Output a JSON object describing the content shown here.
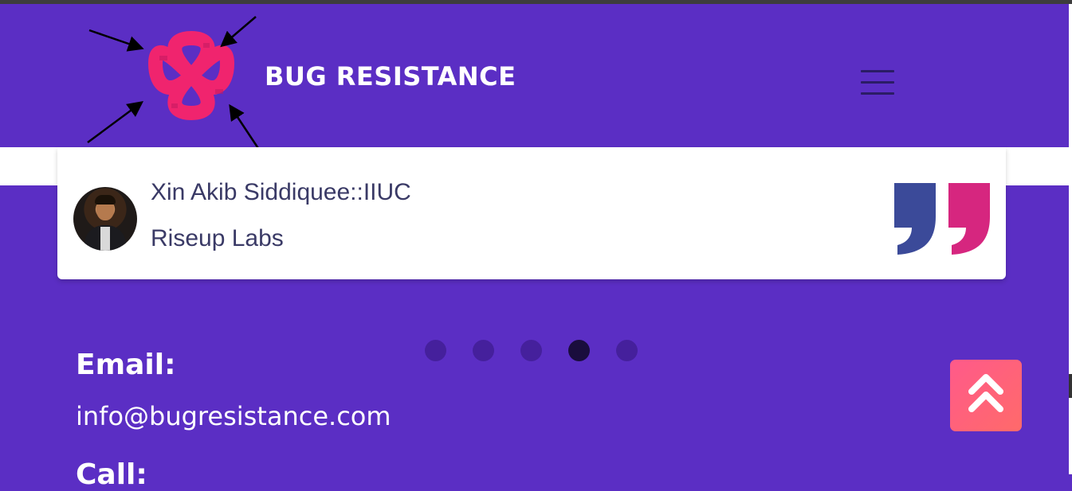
{
  "header": {
    "brand_title": "BUG RESISTANCE",
    "logo_icon": "clover-knot-logo-icon",
    "menu_icon": "hamburger-menu-icon"
  },
  "testimonial": {
    "name": "Xin Akib Siddiquee::IIUC",
    "company": "Riseup Labs",
    "quote_icon": "closing-quote-icon"
  },
  "carousel": {
    "dot_count": 5,
    "active_index": 3
  },
  "contact": {
    "email_label": "Email:",
    "email_value": "info@bugresistance.com",
    "call_label": "Call:"
  },
  "scroll_top": {
    "icon": "double-chevron-up-icon"
  },
  "colors": {
    "background": "#5b2ec4",
    "logo_pink": "#f0246e",
    "quote_blue": "#3b4a99",
    "quote_pink": "#d6267f",
    "scroll_button": "#ff5f7e"
  }
}
